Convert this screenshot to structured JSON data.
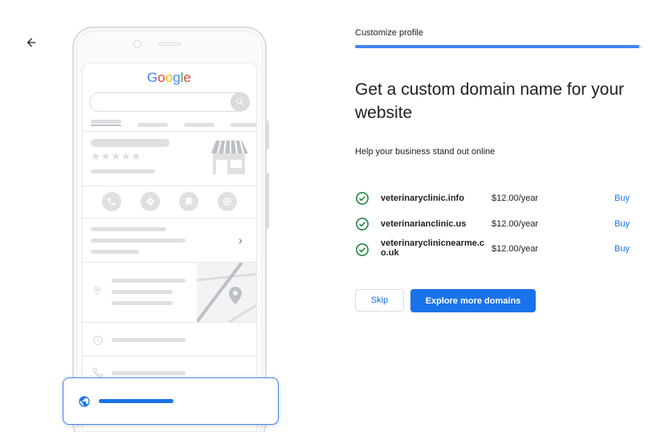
{
  "nav": {
    "back_icon": "arrow-back-icon"
  },
  "illustration": {
    "logo_letters": [
      "G",
      "o",
      "o",
      "g",
      "l",
      "e"
    ],
    "stars": "★★★★★",
    "chevron": "›",
    "colors": {
      "accent": "#1a73e8",
      "placeholder": "#e0e0e0"
    }
  },
  "progress": {
    "step_label": "Customize profile",
    "fraction": 0.99
  },
  "main": {
    "heading": "Get a custom domain name for your website",
    "subtext": "Help your business stand out online"
  },
  "domains": [
    {
      "name": "veterinaryclinic.info",
      "price": "$12.00/year",
      "buy_label": "Buy",
      "available": true
    },
    {
      "name": "veterinarianclinic.us",
      "price": "$12.00/year",
      "buy_label": "Buy",
      "available": true
    },
    {
      "name": "veterinaryclinicnearme.co.uk",
      "price": "$12.00/year",
      "buy_label": "Buy",
      "available": true
    }
  ],
  "actions": {
    "skip_label": "Skip",
    "explore_label": "Explore more domains"
  },
  "colors": {
    "primary": "#1a73e8",
    "success": "#188038",
    "text": "#202124",
    "border": "#dadce0"
  }
}
